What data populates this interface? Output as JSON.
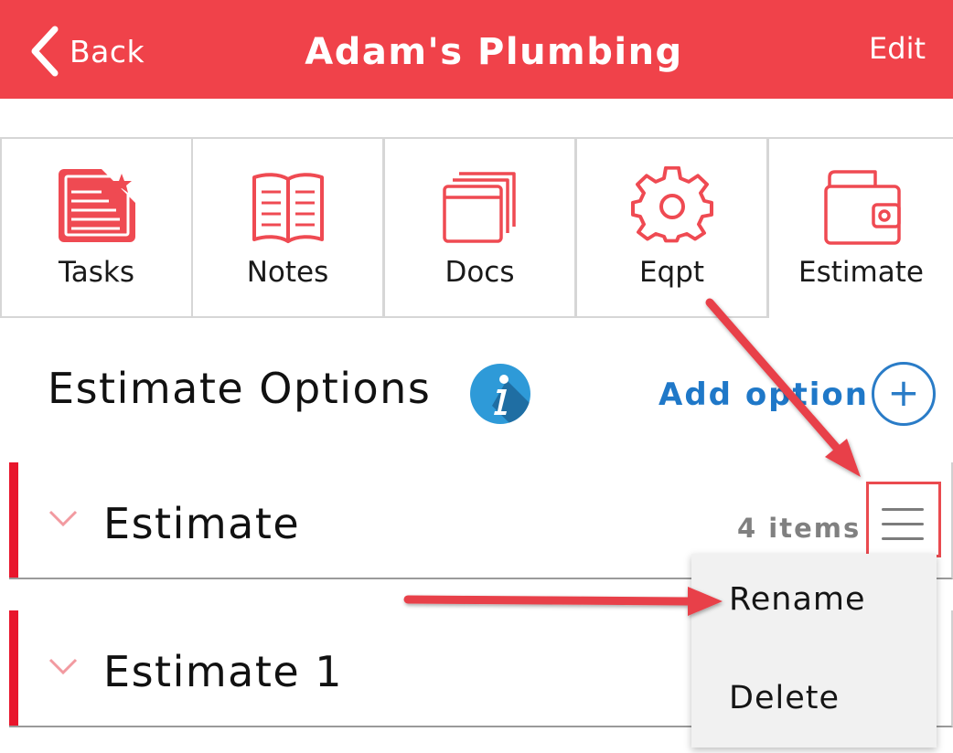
{
  "header": {
    "back_label": "Back",
    "title": "Adam's Plumbing",
    "edit_label": "Edit",
    "background_color": "#f0424a"
  },
  "tabs": [
    {
      "label": "Tasks",
      "icon": "tasks-list-star-icon"
    },
    {
      "label": "Notes",
      "icon": "open-book-icon"
    },
    {
      "label": "Docs",
      "icon": "documents-stack-icon"
    },
    {
      "label": "Eqpt",
      "icon": "gear-icon"
    },
    {
      "label": "Estimate",
      "icon": "wallet-icon",
      "active": true
    }
  ],
  "section": {
    "title": "Estimate Options",
    "info_icon": "info-icon",
    "add_option_label": "Add option",
    "add_icon": "plus-circle-icon"
  },
  "estimates": [
    {
      "name": "Estimate",
      "count": "4 items"
    },
    {
      "name": "Estimate 1"
    }
  ],
  "context_menu": {
    "items": [
      "Rename",
      "Delete"
    ]
  },
  "colors": {
    "accent_red": "#f0424a",
    "row_bar_red": "#e8162c",
    "link_blue": "#1f78c8",
    "annotation_red": "#e8414a"
  }
}
